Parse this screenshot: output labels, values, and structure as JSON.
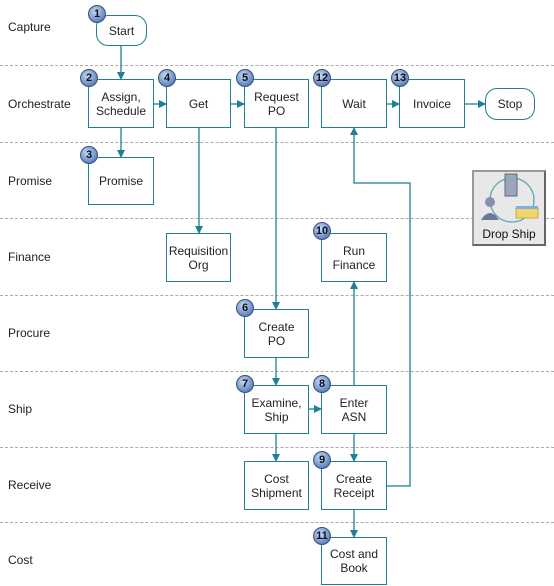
{
  "lanes": [
    "Capture",
    "Orchestrate",
    "Promise",
    "Finance",
    "Procure",
    "Ship",
    "Receive",
    "Cost"
  ],
  "nodes": {
    "start": {
      "label": "Start",
      "badge": "1"
    },
    "assign": {
      "label": "Assign,\nSchedule",
      "badge": "2"
    },
    "promise": {
      "label": "Promise",
      "badge": "3"
    },
    "get": {
      "label": "Get",
      "badge": "4"
    },
    "request_po": {
      "label": "Request\nPO",
      "badge": "5"
    },
    "create_po": {
      "label": "Create\nPO",
      "badge": "6"
    },
    "examine": {
      "label": "Examine,\nShip",
      "badge": "7"
    },
    "enter_asn": {
      "label": "Enter\nASN",
      "badge": "8"
    },
    "create_receipt": {
      "label": "Create\nReceipt",
      "badge": "9"
    },
    "run_finance": {
      "label": "Run\nFinance",
      "badge": "10"
    },
    "cost_book": {
      "label": "Cost and\nBook",
      "badge": "11"
    },
    "wait": {
      "label": "Wait",
      "badge": "12"
    },
    "invoice": {
      "label": "Invoice",
      "badge": "13"
    },
    "stop": {
      "label": "Stop"
    },
    "requisition": {
      "label": "Requisition\nOrg"
    },
    "cost_shipment": {
      "label": "Cost\nShipment"
    }
  },
  "drop_ship": {
    "label": "Drop Ship"
  },
  "colors": {
    "line": "#1f7f93",
    "badge": "#6f92c9"
  }
}
